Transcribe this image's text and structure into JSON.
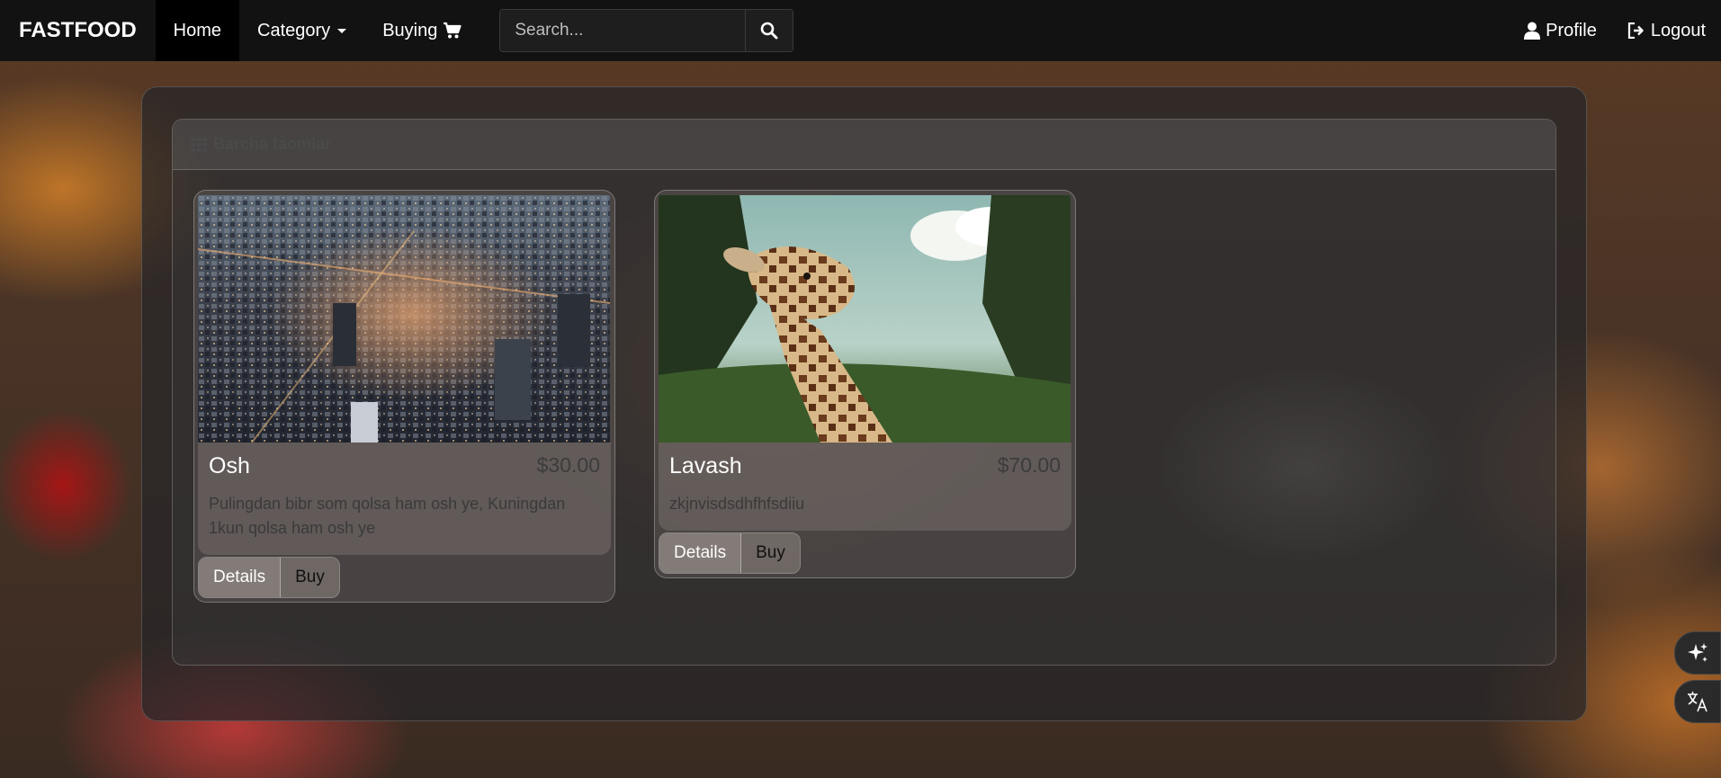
{
  "navbar": {
    "brand": "FASTFOOD",
    "items": [
      {
        "label": "Home",
        "active": true
      },
      {
        "label": "Category"
      },
      {
        "label": "Buying"
      }
    ],
    "search": {
      "placeholder": "Search...",
      "value": ""
    },
    "right_items": [
      {
        "label": "Profile",
        "icon": "user-icon"
      },
      {
        "label": "Logout",
        "icon": "logout-icon"
      }
    ]
  },
  "panel": {
    "title": "Barcha taomlar",
    "icon": "grid-icon"
  },
  "products": [
    {
      "title": "Osh",
      "price": "$30.00",
      "description": "Pulingdan bibr som qolsa ham osh ye, Kuningdan 1kun qolsa ham osh ye",
      "image": "city-night-aerial-photo",
      "details_label": "Details",
      "buy_label": "Buy"
    },
    {
      "title": "Lavash",
      "price": "$70.00",
      "description": "zkjnvisdsdhfhfsdiiu",
      "image": "giraffe-forest-photo",
      "details_label": "Details",
      "buy_label": "Buy"
    }
  ],
  "floating_buttons": [
    {
      "icon": "sparkle-icon"
    },
    {
      "icon": "translate-icon"
    }
  ],
  "colors": {
    "navbar_bg": "#121212",
    "active_bg": "#000000",
    "text": "#ffffff"
  }
}
